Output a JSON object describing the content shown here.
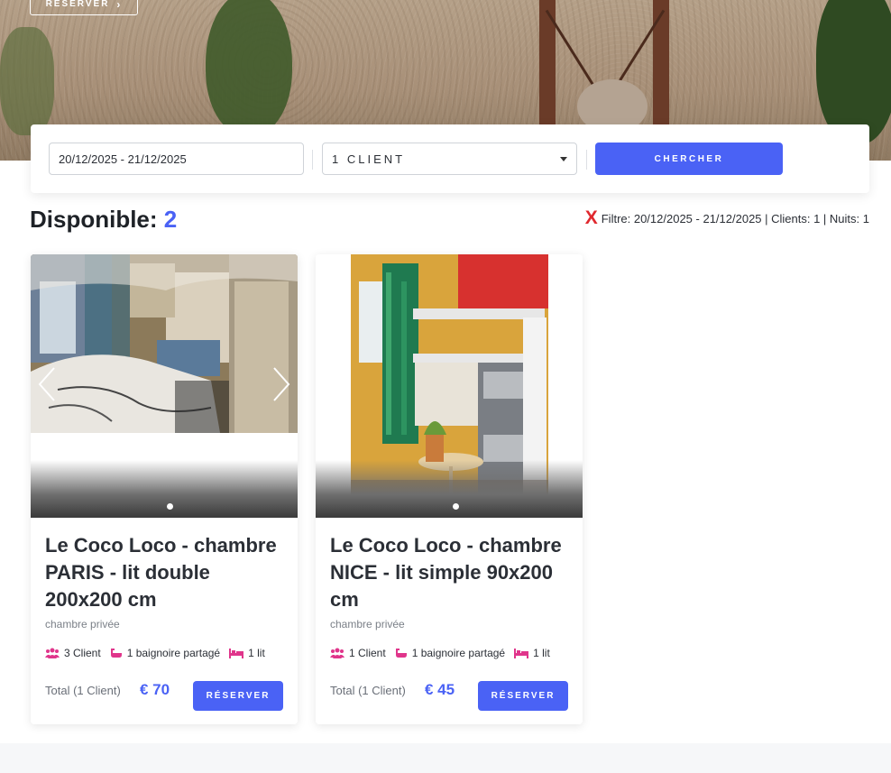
{
  "hero": {
    "reserve_label": "RÉSERVER",
    "reserve_arrow": "›"
  },
  "search": {
    "dates_value": "20/12/2025 - 21/12/2025",
    "clients_value": "1 CLIENT",
    "search_label": "CHERCHER"
  },
  "results": {
    "available_label": "Disponible:",
    "available_count": "2",
    "filter_x": "X",
    "filter_text": "Filtre: 20/12/2025 - 21/12/2025 | Clients: 1 | Nuits: 1"
  },
  "rooms": [
    {
      "title": "Le Coco Loco - chambre PARIS - lit double 200x200 cm",
      "subtitle": "chambre privée",
      "guests": "3 Client",
      "bath": "1 baignoire partagé",
      "beds": "1 lit",
      "total_label": "Total (1 Client)",
      "price": "€ 70",
      "reserve_label": "RÉSERVER"
    },
    {
      "title": "Le Coco Loco - chambre NICE - lit simple 90x200 cm",
      "subtitle": "chambre privée",
      "guests": "1 Client",
      "bath": "1 baignoire partagé",
      "beds": "1 lit",
      "total_label": "Total (1 Client)",
      "price": "€ 45",
      "reserve_label": "RÉSERVER"
    }
  ],
  "colors": {
    "accent": "#4a62f5",
    "icon_pink": "#e0358b",
    "filter_x": "#e0282e"
  }
}
